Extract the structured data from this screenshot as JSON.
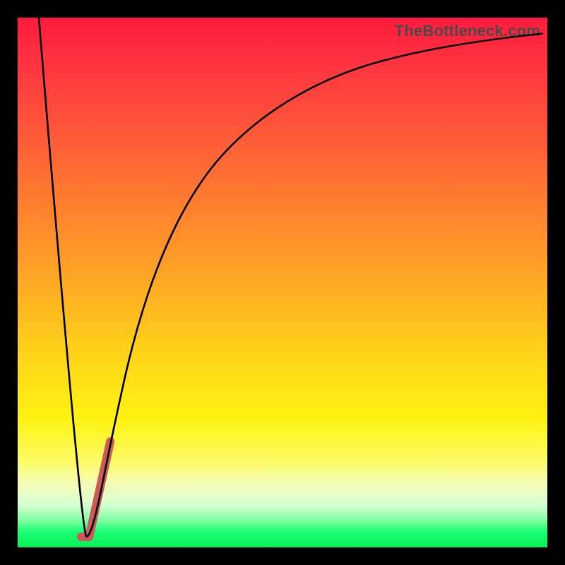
{
  "watermark": "TheBottleneck.com",
  "chart_data": {
    "type": "line",
    "title": "",
    "xlabel": "",
    "ylabel": "",
    "xlim": [
      0,
      100
    ],
    "ylim": [
      0,
      100
    ],
    "grid": false,
    "series": [
      {
        "name": "black-curve",
        "color": "#000000",
        "width": 2.2,
        "x": [
          4,
          12,
          14,
          18,
          22,
          27,
          33,
          40,
          50,
          62,
          75,
          88,
          99
        ],
        "values": [
          100,
          2,
          2,
          22,
          40,
          55,
          67,
          76,
          84,
          90,
          93.5,
          95.7,
          97
        ]
      },
      {
        "name": "red-segment",
        "color": "#cc5a5a",
        "width": 10,
        "x": [
          12,
          13.5,
          17.5
        ],
        "values": [
          2,
          2,
          20
        ]
      }
    ],
    "background_gradient": {
      "top": "#ff1a3d",
      "bottom": "#05ef57",
      "stops": [
        {
          "pct": 0,
          "color": "#ff1a3d"
        },
        {
          "pct": 10,
          "color": "#ff3740"
        },
        {
          "pct": 28,
          "color": "#ff6a34"
        },
        {
          "pct": 48,
          "color": "#ffa326"
        },
        {
          "pct": 64,
          "color": "#ffd519"
        },
        {
          "pct": 76,
          "color": "#fff312"
        },
        {
          "pct": 84,
          "color": "#fdfb6a"
        },
        {
          "pct": 88,
          "color": "#f6fcb6"
        },
        {
          "pct": 92,
          "color": "#d5ffd3"
        },
        {
          "pct": 95,
          "color": "#7dffa1"
        },
        {
          "pct": 97,
          "color": "#1cff74"
        },
        {
          "pct": 100,
          "color": "#05ef57"
        }
      ]
    }
  }
}
